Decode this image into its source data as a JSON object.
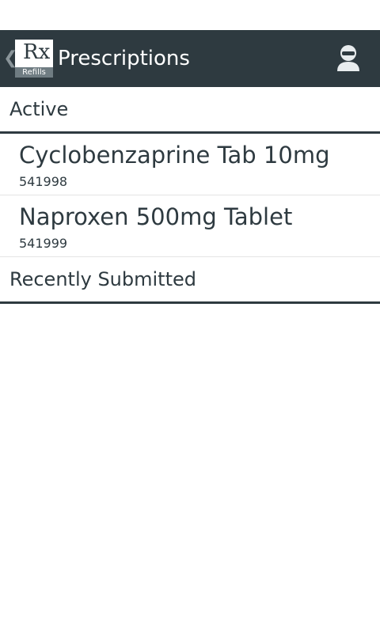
{
  "header": {
    "title": "Prescriptions",
    "logo_text": "Rx",
    "logo_sub": "Refills",
    "back_icon": "chevron-left-icon",
    "account_icon": "user-icon"
  },
  "sections": {
    "active": "Active",
    "recent": "Recently Submitted"
  },
  "prescriptions": [
    {
      "name": "Cyclobenzaprine Tab 10mg",
      "number": "541998"
    },
    {
      "name": "Naproxen 500mg Tablet",
      "number": "541999"
    }
  ],
  "colors": {
    "action_bar": "#2e3a40",
    "text": "#2e3a40"
  }
}
